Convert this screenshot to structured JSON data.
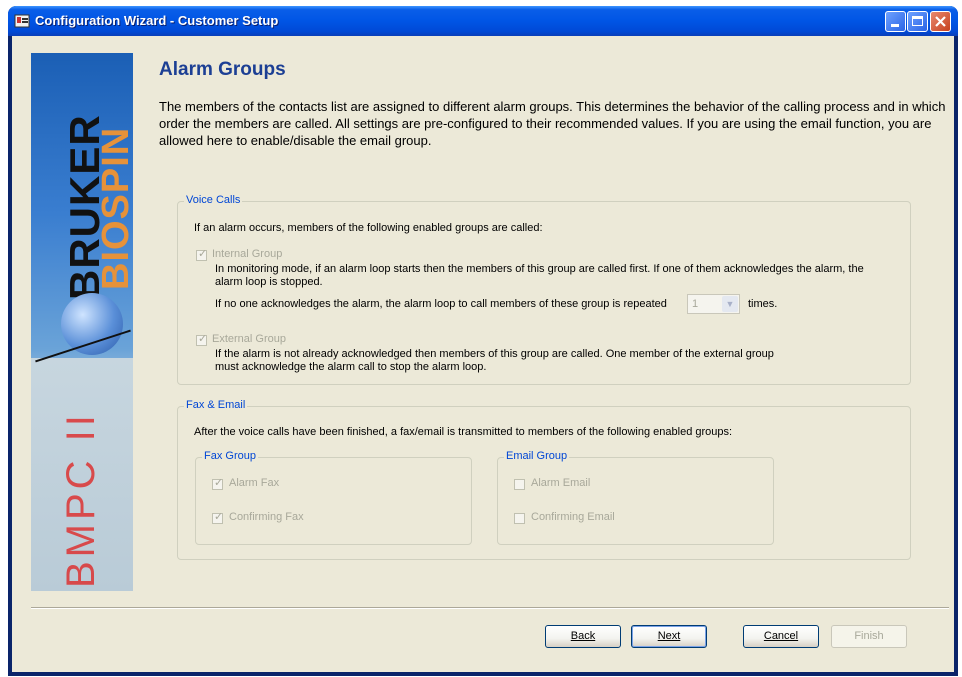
{
  "window": {
    "title": "Configuration Wizard - Customer Setup"
  },
  "banner": {
    "brand_top": "BRUKER",
    "brand_bottom": "BIOSPIN",
    "product": "BMPC II"
  },
  "page": {
    "heading": "Alarm Groups",
    "description": "The members of the contacts list are assigned to different alarm groups. This determines the behavior of the calling process and in which order the members are called. All settings are pre-configured to their recommended values. If you are using the email function, you are allowed here to enable/disable the email group."
  },
  "voice_calls": {
    "legend": "Voice Calls",
    "intro": "If an alarm occurs, members of the following enabled groups are called:",
    "internal": {
      "label": "Internal Group",
      "checked": true,
      "description": "In monitoring mode, if an alarm loop starts then the members of this group are called first. If one of them acknowledges the alarm, the alarm loop is stopped.",
      "repeat_prefix": "If no one acknowledges the alarm, the alarm loop to call members of these group is repeated",
      "repeat_value": "1",
      "repeat_suffix": "times."
    },
    "external": {
      "label": "External Group",
      "checked": true,
      "description": "If the alarm is not already acknowledged then members of this group are called. One member of the external group must acknowledge the alarm call to stop the alarm loop."
    }
  },
  "fax_email": {
    "legend": "Fax & Email",
    "intro": "After the voice calls have been finished, a fax/email is transmitted to members of the following enabled groups:",
    "fax_group": {
      "legend": "Fax Group",
      "alarm_label": "Alarm Fax",
      "alarm_checked": true,
      "confirm_label": "Confirming Fax",
      "confirm_checked": true
    },
    "email_group": {
      "legend": "Email Group",
      "alarm_label": "Alarm Email",
      "alarm_checked": false,
      "confirm_label": "Confirming Email",
      "confirm_checked": false
    }
  },
  "buttons": {
    "back": "Back",
    "next": "Next",
    "cancel": "Cancel",
    "finish": "Finish"
  },
  "colors": {
    "title_bar": "#0055e5",
    "heading": "#1c3f94",
    "legend": "#0046d5",
    "dialog_bg": "#ece9d8"
  }
}
